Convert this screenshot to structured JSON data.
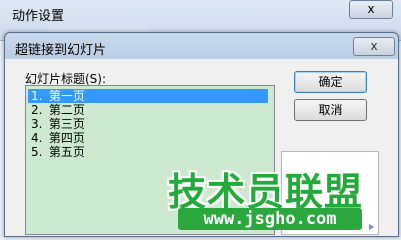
{
  "background_window": {
    "title": "动作设置",
    "close_label": "x"
  },
  "dialog": {
    "title": "超链接到幻灯片",
    "close_label": "x",
    "list_label": "幻灯片标题(S):",
    "slides": [
      {
        "num": "1.",
        "label": "第一页",
        "selected": true
      },
      {
        "num": "2.",
        "label": "第二页",
        "selected": false
      },
      {
        "num": "3.",
        "label": "第三页",
        "selected": false
      },
      {
        "num": "4.",
        "label": "第四页",
        "selected": false
      },
      {
        "num": "5.",
        "label": "第五页",
        "selected": false
      }
    ],
    "ok_label": "确定",
    "cancel_label": "取消"
  },
  "watermark": {
    "brand": "技术员联盟",
    "url": "www.jsgho.com"
  },
  "colors": {
    "list_background": "#cde9d0",
    "selection": "#3399ff",
    "watermark_green": "#22aa3a"
  }
}
